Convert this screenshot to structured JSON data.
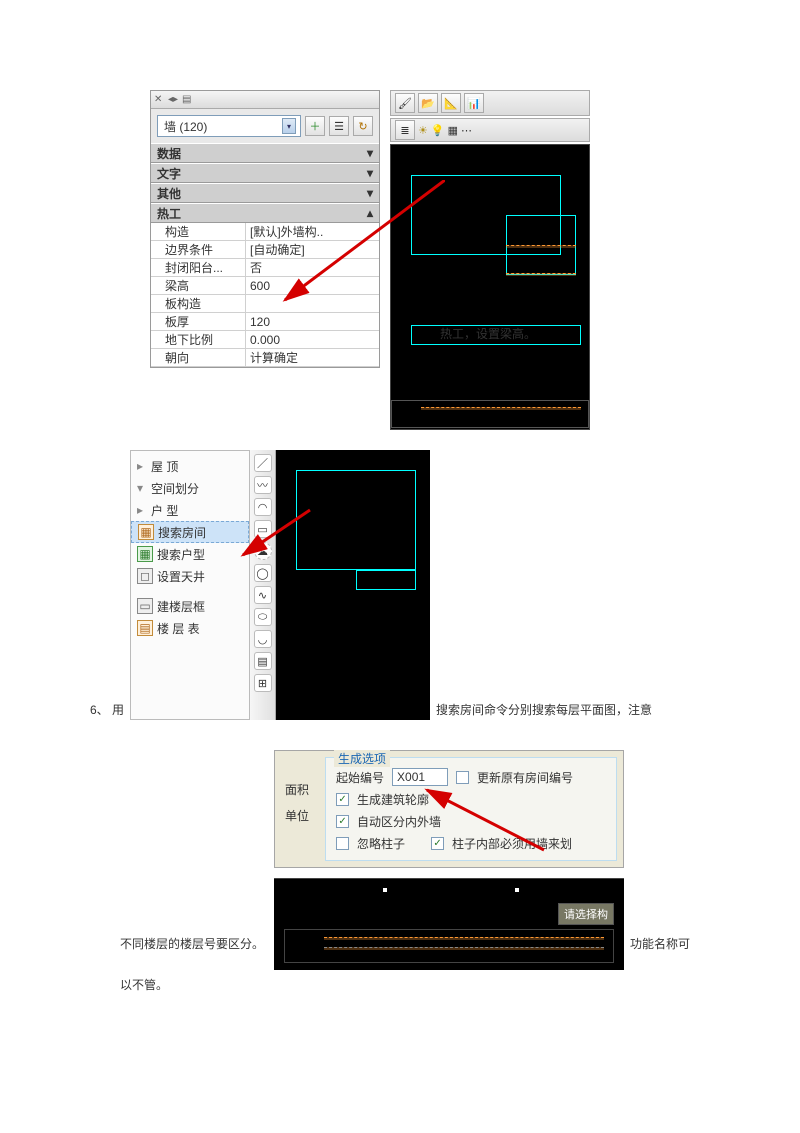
{
  "screenshot1": {
    "select_value": "墙 (120)",
    "sections": {
      "data": "数据",
      "text": "文字",
      "other": "其他",
      "thermal": "热工"
    },
    "rows": [
      {
        "label": "构造",
        "value": "[默认]外墙构.."
      },
      {
        "label": "边界条件",
        "value": "[自动确定]"
      },
      {
        "label": "封闭阳台...",
        "value": "否"
      },
      {
        "label": "梁高",
        "value": "600"
      },
      {
        "label": "板构造",
        "value": ""
      },
      {
        "label": "板厚",
        "value": "120"
      },
      {
        "label": "地下比例",
        "value": "0.000"
      },
      {
        "label": "朝向",
        "value": "计算确定"
      }
    ],
    "caption": "热工，设置梁高。"
  },
  "screenshot2": {
    "pre": "6、 用",
    "items": {
      "wuling": "屋 顶",
      "space": "空间划分",
      "huxing": "户  型",
      "search_room": "搜索房间",
      "search_hx": "搜索户型",
      "set_tj": "设置天井",
      "build_frame": "建楼层框",
      "floor_table": "楼 层 表"
    },
    "post": "搜索房间命令分别搜索每层平面图，注意"
  },
  "screenshot3": {
    "pre": "不同楼层的楼层号要区分。",
    "legend": "生成选项",
    "left_area": "面积",
    "left_unit": "单位",
    "start_label": "起始编号",
    "start_value": "X001",
    "cb_update": "更新原有房间编号",
    "cb_outline": "生成建筑轮廓",
    "cb_autowall": "自动区分内外墙",
    "cb_ignorecol": "忽略柱子",
    "cb_colwall": "柱子内部必须用墙来划",
    "tooltip": "请选择构",
    "post": "功能名称可",
    "lastline": "以不管。"
  }
}
